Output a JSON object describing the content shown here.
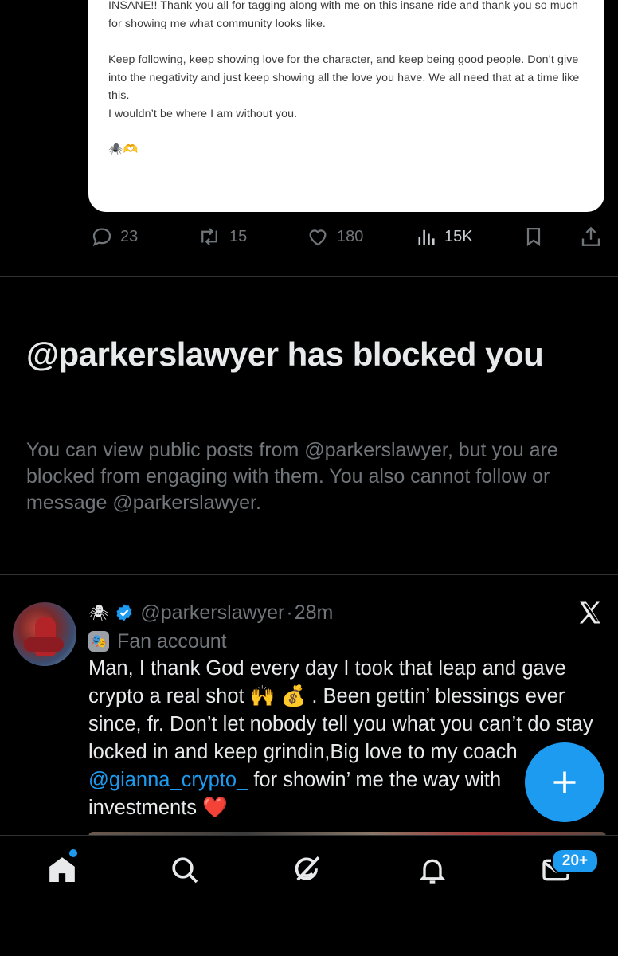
{
  "quoted_card": {
    "paragraph1": "INSANE!! Thank you all for tagging along with me on this insane ride and thank you so much for showing me what community looks like.",
    "paragraph2": "Keep following, keep showing love for the character, and keep being good people. Don’t give into the negativity and just keep showing all the love you have. We all need that at a time like this.",
    "paragraph3": "I wouldn’t be where I am without you.",
    "emojis": "🕷️🫶"
  },
  "actions": {
    "replies": "23",
    "reposts": "15",
    "likes": "180",
    "views": "15K"
  },
  "blocked_notice": {
    "title": "@parkerslawyer has blocked you",
    "description": "You can view public posts from @parkerslawyer, but you are blocked from engaging with them. You also cannot follow or message @parkerslawyer."
  },
  "post": {
    "name_emoji": "🕷",
    "handle": "@parkerslawyer",
    "separator": "·",
    "time": "28m",
    "label_emoji": "🎭",
    "label": "Fan account",
    "text_part1": "Man, I thank God every day I took that leap and gave crypto a real shot 🙌 💰 . Been gettin’ blessings ever since, fr. Don’t let nobody tell you what you can’t do stay locked in and keep grindin,Big love to my coach ",
    "mention": "@gianna_crypto_",
    "text_part2": " for showin’ me the way with investments ❤️"
  },
  "tabbar": {
    "messages_badge": "20+"
  },
  "colors": {
    "accent": "#1d9bf0",
    "muted": "#71767b",
    "divider": "#2f3336",
    "background": "#000000"
  },
  "icons": [
    "reply-icon",
    "repost-icon",
    "like-icon",
    "views-icon",
    "bookmark-icon",
    "share-icon",
    "verified-icon",
    "x-logo-icon",
    "compose-icon",
    "home-icon",
    "search-icon",
    "grok-icon",
    "notifications-icon",
    "messages-icon"
  ]
}
